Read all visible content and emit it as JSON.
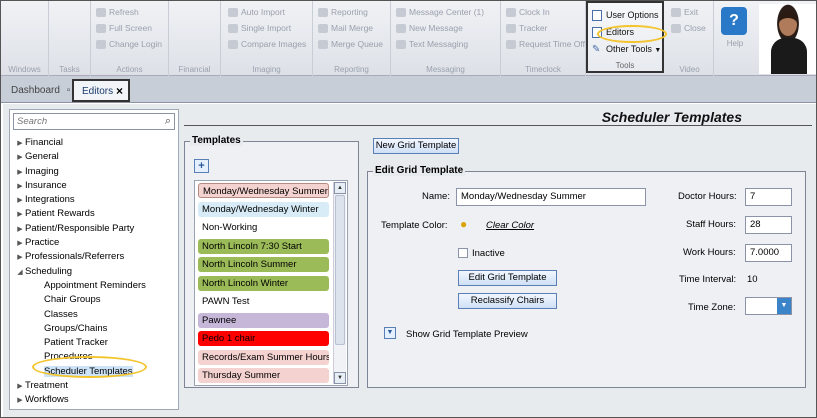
{
  "ribbon": {
    "groups": [
      {
        "label": "Windows",
        "items": []
      },
      {
        "label": "Tasks",
        "items": []
      },
      {
        "label": "Actions",
        "items": [
          "Refresh",
          "Full Screen",
          "Change Login"
        ]
      },
      {
        "label": "Financial",
        "items": []
      },
      {
        "label": "Imaging",
        "items": [
          "Auto Import",
          "Single Import",
          "Compare Images"
        ]
      },
      {
        "label": "Reporting",
        "items": [
          "Reporting",
          "Mail Merge",
          "Merge Queue"
        ]
      },
      {
        "label": "Messaging",
        "items": [
          "Message Center (1)",
          "New Message",
          "Text Messaging"
        ]
      },
      {
        "label": "Timeclock",
        "items": [
          "Clock In",
          "Tracker",
          "Request Time Off"
        ]
      },
      {
        "label": "Video",
        "items": [
          "Exit",
          "Close",
          "Video"
        ]
      }
    ],
    "tools": {
      "items": [
        "User Options",
        "Editors",
        "Other Tools"
      ],
      "label": "Tools"
    },
    "help_label": "Help"
  },
  "tabs": [
    {
      "label": "Dashboard"
    },
    {
      "label": "Editors"
    }
  ],
  "search": {
    "placeholder": "Search"
  },
  "tree": {
    "top": [
      "Financial",
      "General",
      "Imaging",
      "Insurance",
      "Integrations",
      "Patient Rewards",
      "Patient/Responsible Party",
      "Practice",
      "Professionals/Referrers",
      "Scheduling"
    ],
    "scheduling_children": [
      "Appointment Reminders",
      "Chair Groups",
      "Classes",
      "Groups/Chains",
      "Patient Tracker",
      "Procedures",
      "Scheduler Templates"
    ],
    "bottom": [
      "Treatment",
      "Workflows"
    ]
  },
  "page_title": "Scheduler Templates",
  "templates": {
    "legend": "Templates",
    "new_button": "New Grid Template",
    "items": [
      {
        "label": "Monday/Wednesday Summer",
        "color": "#f4d2cf"
      },
      {
        "label": "Monday/Wednesday Winter",
        "color": "#d7ecf6"
      },
      {
        "label": "Non-Working",
        "color": "#ffffff"
      },
      {
        "label": "North Lincoln 7:30 Start",
        "color": "#9bbb59"
      },
      {
        "label": "North Lincoln Summer",
        "color": "#9bbb59"
      },
      {
        "label": "North Lincoln Winter",
        "color": "#9bbb59"
      },
      {
        "label": "PAWN Test",
        "color": "#ffffff"
      },
      {
        "label": "Pawnee",
        "color": "#c6b6d8"
      },
      {
        "label": "Pedo 1 chair",
        "color": "#ff0000"
      },
      {
        "label": "Records/Exam Summer Hours",
        "color": "#f4d2cf"
      },
      {
        "label": "Thursday Summer",
        "color": "#f4d2cf"
      }
    ]
  },
  "edit": {
    "legend": "Edit Grid Template",
    "name_label": "Name:",
    "name_value": "Monday/Wednesday Summer",
    "color_label": "Template Color:",
    "clear_color": "Clear Color",
    "inactive_label": "Inactive",
    "edit_button": "Edit Grid Template",
    "reclassify_button": "Reclassify Chairs",
    "preview_label": "Show Grid Template Preview",
    "doctor_hours_label": "Doctor Hours:",
    "doctor_hours": "7",
    "staff_hours_label": "Staff Hours:",
    "staff_hours": "28",
    "work_hours_label": "Work Hours:",
    "work_hours": "7.0000",
    "time_interval_label": "Time Interval:",
    "time_interval": "10",
    "time_zone_label": "Time Zone:",
    "time_zone": ""
  }
}
